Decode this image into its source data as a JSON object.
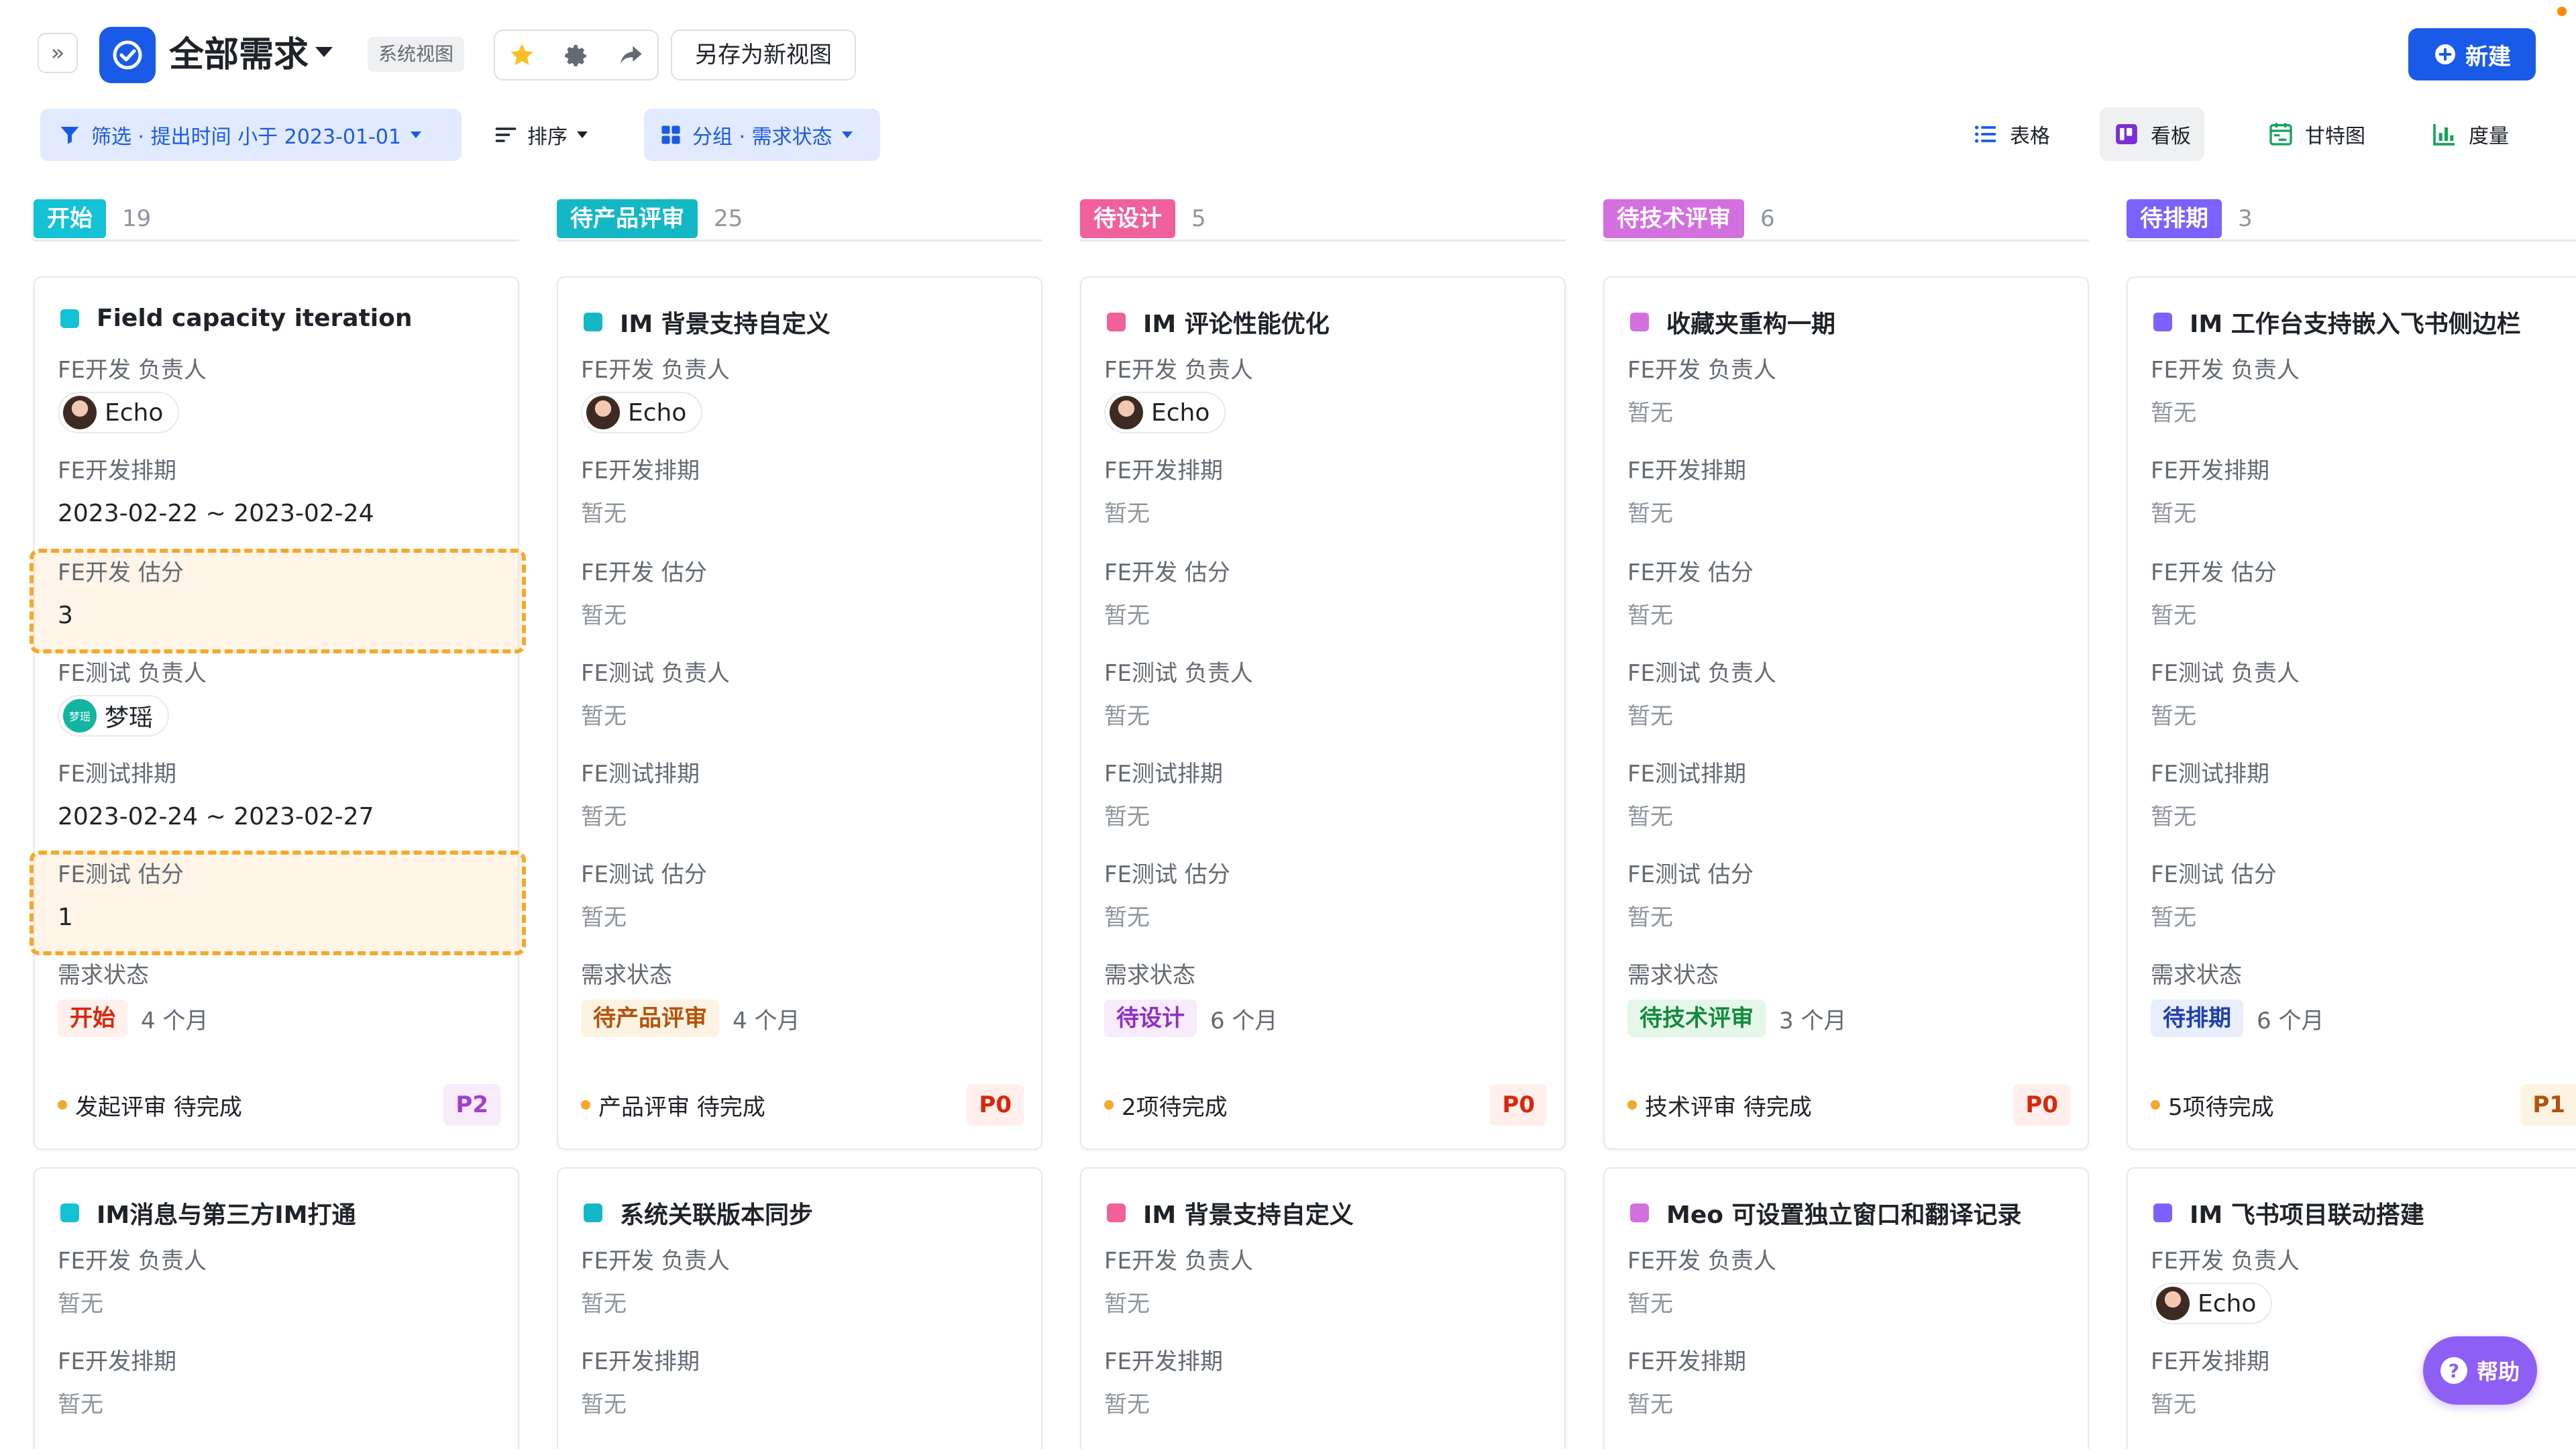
{
  "header": {
    "title": "全部需求",
    "system_badge": "系统视图",
    "save_as_label": "另存为新视图",
    "new_label": "新建"
  },
  "toolbar": {
    "filter_label": "筛选 · 提出时间 小于 2023-01-01",
    "sort_label": "排序",
    "group_label": "分组 · 需求状态",
    "views": [
      {
        "label": "表格",
        "icon": "list-icon"
      },
      {
        "label": "看板",
        "icon": "kanban-icon",
        "active": true
      },
      {
        "label": "甘特图",
        "icon": "gantt-icon"
      },
      {
        "label": "度量",
        "icon": "chart-icon"
      }
    ]
  },
  "colors": {
    "col_start": "#13c2d5",
    "col_pending_review": "#14b8c4",
    "col_pending_design": "#f0609b",
    "col_tech_review": "#d46fe0",
    "col_schedule": "#7b61ff",
    "accent": "#1a5ae8"
  },
  "labels": {
    "fe_dev_owner": "FE开发 负责人",
    "fe_dev_schedule": "FE开发排期",
    "fe_dev_estimate": "FE开发 估分",
    "fe_test_owner": "FE测试 负责人",
    "fe_test_schedule": "FE测试排期",
    "fe_test_estimate": "FE测试 估分",
    "status": "需求状态",
    "empty": "暂无"
  },
  "columns": [
    {
      "name": "开始",
      "count": "19",
      "cards": [
        {
          "title": "Field capacity iteration",
          "dev_owner": "Echo",
          "dev_schedule": "2023-02-22 ~ 2023-02-24",
          "dev_estimate": "3",
          "test_owner": "梦瑶",
          "test_owner_avatar_text": "梦瑶",
          "test_schedule": "2023-02-24 ~ 2023-02-27",
          "test_estimate": "1",
          "status": "开始",
          "duration": "4 个月",
          "footer": "发起评审 待完成",
          "priority": "P2"
        },
        {
          "title": "IM消息与第三方IM打通"
        }
      ]
    },
    {
      "name": "待产品评审",
      "count": "25",
      "cards": [
        {
          "title": "IM 背景支持自定义",
          "dev_owner": "Echo",
          "status": "待产品评审",
          "duration": "4 个月",
          "footer": "产品评审 待完成",
          "priority": "P0"
        },
        {
          "title": "系统关联版本同步"
        }
      ]
    },
    {
      "name": "待设计",
      "count": "5",
      "cards": [
        {
          "title": "IM 评论性能优化",
          "dev_owner": "Echo",
          "status": "待设计",
          "duration": "6 个月",
          "footer": "2项待完成",
          "priority": "P0"
        },
        {
          "title": "IM 背景支持自定义"
        }
      ]
    },
    {
      "name": "待技术评审",
      "count": "6",
      "cards": [
        {
          "title": "收藏夹重构一期",
          "status": "待技术评审",
          "duration": "3 个月",
          "footer": "技术评审 待完成",
          "priority": "P0"
        },
        {
          "title": "Meo 可设置独立窗口和翻译记录"
        }
      ]
    },
    {
      "name": "待排期",
      "count": "3",
      "cards": [
        {
          "title": "IM 工作台支持嵌入飞书侧边栏",
          "status": "待排期",
          "duration": "6 个月",
          "footer": "5项待完成",
          "priority": "P1"
        },
        {
          "title": "IM 飞书项目联动搭建",
          "dev_owner": "Echo"
        }
      ]
    }
  ],
  "help_label": "帮助"
}
